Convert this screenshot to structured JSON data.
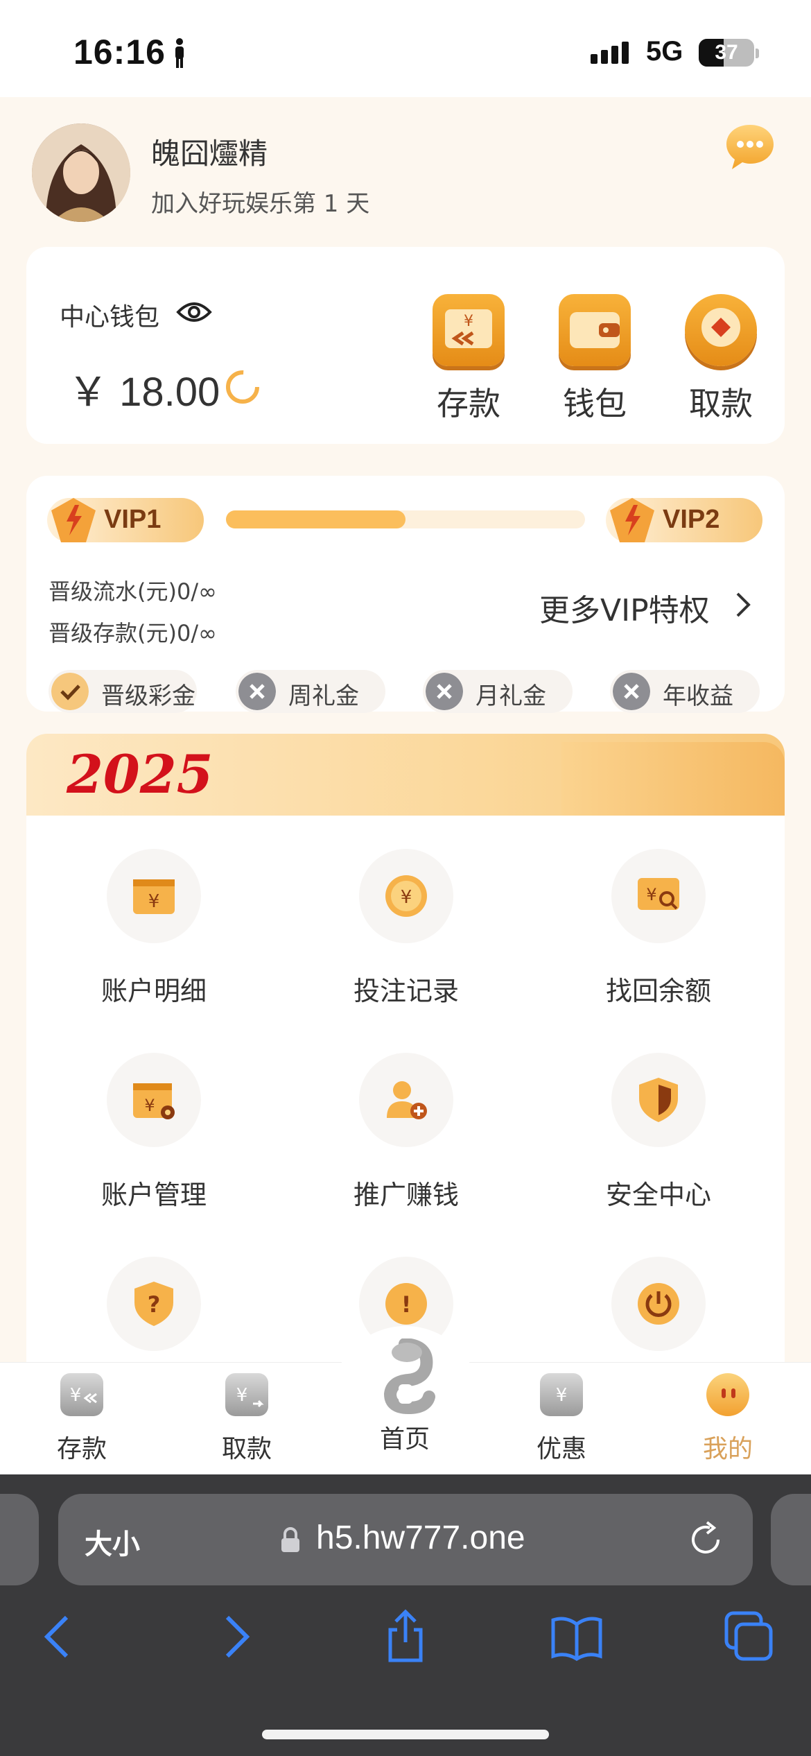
{
  "status_bar": {
    "time": "16:16",
    "network": "5G",
    "battery": "37"
  },
  "profile": {
    "username": "魄囧爧精",
    "join_text": "加入好玩娱乐第 1 天"
  },
  "wallet": {
    "label": "中心钱包",
    "amount": "￥ 18.00",
    "buttons": [
      {
        "label": "存款",
        "icon": "deposit-icon"
      },
      {
        "label": "钱包",
        "icon": "wallet-icon"
      },
      {
        "label": "取款",
        "icon": "withdraw-icon"
      }
    ]
  },
  "vip": {
    "current": "VIP1",
    "next": "VIP2",
    "progress": 0.5,
    "turnover_line": "晋级流水(元)0/∞",
    "deposit_line": "晋级存款(元)0/∞",
    "more_link": "更多VIP特权",
    "perks": [
      {
        "label": "晋级彩金",
        "enabled": true
      },
      {
        "label": "周礼金",
        "enabled": false
      },
      {
        "label": "月礼金",
        "enabled": false
      },
      {
        "label": "年收益",
        "enabled": false
      }
    ]
  },
  "banner": {
    "year": "2025"
  },
  "menu": {
    "items": [
      {
        "label": "账户明细",
        "icon": "account-detail-icon"
      },
      {
        "label": "投注记录",
        "icon": "bet-record-icon"
      },
      {
        "label": "找回余额",
        "icon": "recover-balance-icon"
      },
      {
        "label": "账户管理",
        "icon": "account-manage-icon"
      },
      {
        "label": "推广赚钱",
        "icon": "promote-icon"
      },
      {
        "label": "安全中心",
        "icon": "security-icon"
      },
      {
        "label": "",
        "icon": "help-icon"
      },
      {
        "label": "",
        "icon": "notice-icon"
      },
      {
        "label": "",
        "icon": "logout-icon"
      }
    ]
  },
  "tabbar": {
    "tabs": [
      {
        "label": "存款",
        "icon": "deposit-tab-icon"
      },
      {
        "label": "取款",
        "icon": "withdraw-tab-icon"
      },
      {
        "label": "首页",
        "icon": "snake-home-icon"
      },
      {
        "label": "优惠",
        "icon": "promo-tab-icon"
      },
      {
        "label": "我的",
        "icon": "mine-tab-icon"
      }
    ],
    "active": "我的"
  },
  "browser": {
    "text_size": "大小",
    "url": "h5.hw777.one"
  },
  "colors": {
    "accent": "#f5a623",
    "active_tab": "#d9a15a",
    "background": "#fdf7ef"
  }
}
